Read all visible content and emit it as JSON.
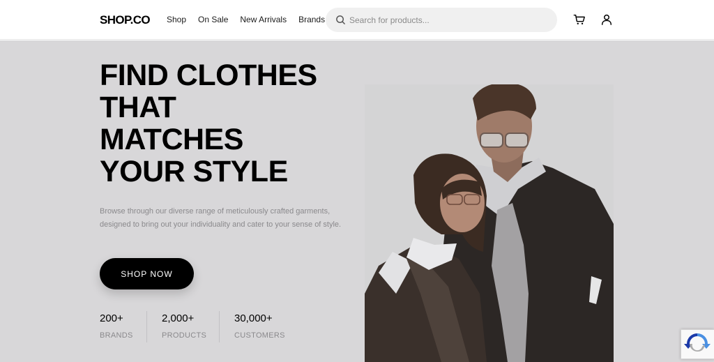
{
  "header": {
    "logo": "SHOP.CO",
    "nav": [
      "Shop",
      "On Sale",
      "New Arrivals",
      "Brands"
    ],
    "search_placeholder": "Search for products..."
  },
  "hero": {
    "headline": [
      "FIND CLOTHES",
      "THAT",
      "MATCHES",
      "YOUR STYLE"
    ],
    "description": "Browse through our diverse range of meticulously crafted garments, designed to bring out your individuality and cater to your sense of style.",
    "cta_label": "SHOP NOW",
    "stats": [
      {
        "value": "200+",
        "label": "BRANDS"
      },
      {
        "value": "2,000+",
        "label": "PRODUCTS"
      },
      {
        "value": "30,000+",
        "label": "CUSTOMERS"
      }
    ]
  },
  "icons": {
    "search": "search-icon",
    "cart": "cart-icon",
    "user": "user-icon",
    "recaptcha": "recaptcha-icon"
  },
  "colors": {
    "hero_background": "#d8d7d9",
    "button_background": "#000000",
    "search_background": "#f0f0f0",
    "muted_text": "#8a898c"
  }
}
